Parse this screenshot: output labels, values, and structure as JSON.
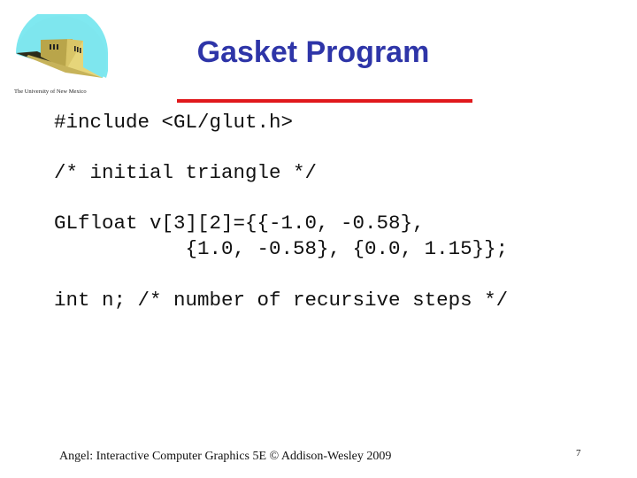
{
  "header": {
    "logo_caption": "The University of New Mexico",
    "title": "Gasket Program",
    "accent_color": "#e0191c",
    "title_color": "#2e35a8"
  },
  "code": {
    "lines": [
      "#include <GL/glut.h>",
      "/* initial triangle */",
      "GLfloat v[3][2]={{-1.0, -0.58},",
      "           {1.0, -0.58}, {0.0, 1.15}};",
      "int n; /* number of recursive steps */"
    ]
  },
  "footer": {
    "credit": "Angel: Interactive Computer Graphics 5E © Addison-Wesley 2009",
    "page_number": "7"
  }
}
